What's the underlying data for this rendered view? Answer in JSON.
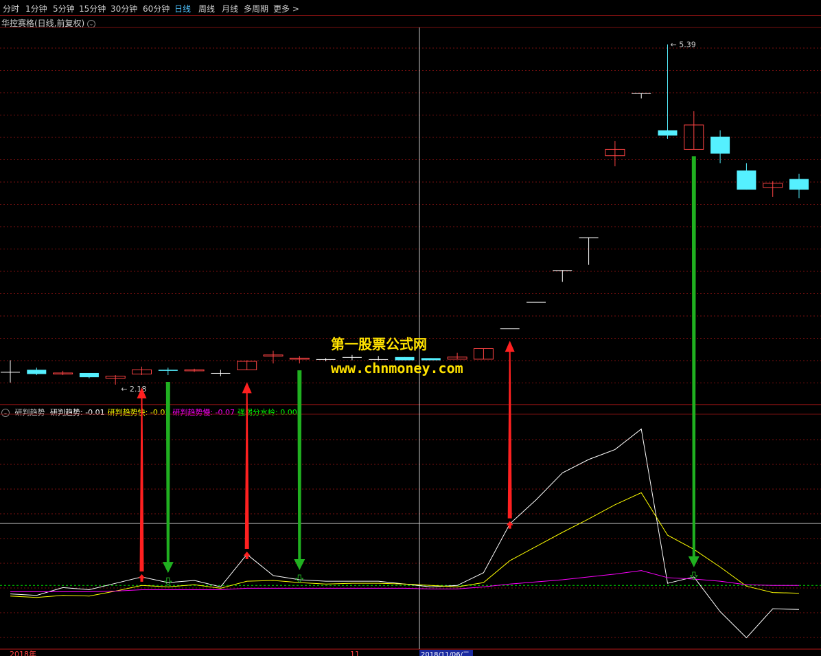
{
  "toolbar": {
    "items": [
      {
        "label": "分时"
      },
      {
        "label": "1分钟"
      },
      {
        "label": "5分钟"
      },
      {
        "label": "15分钟"
      },
      {
        "label": "30分钟"
      },
      {
        "label": "60分钟"
      },
      {
        "label": "日线",
        "active": true
      },
      {
        "label": "周线"
      },
      {
        "label": "月线"
      },
      {
        "label": "多周期"
      },
      {
        "label": "更多 >"
      }
    ]
  },
  "stock": {
    "title": "华控赛格(日线,前复权)",
    "menu_icon": "chevron-down-circle-icon"
  },
  "price_labels": {
    "low": "2.18",
    "high": "5.39"
  },
  "indicator": {
    "name": "研判趋势",
    "values": [
      {
        "label": "研判趋势: -0.01",
        "color": "#ffffff"
      },
      {
        "label": "研判趋势快: -0.01",
        "color": "#ffff00"
      },
      {
        "label": "研判趋势慢: -0.07",
        "color": "#ff00ff"
      },
      {
        "label": "强弱分水岭: 0.00",
        "color": "#00ff00"
      }
    ]
  },
  "axis": {
    "year": "2018年",
    "month": "11",
    "cursor_date": "2018/11/06/二"
  },
  "watermark": {
    "line1": "第一股票公式网",
    "line2": "www.chnmoney.com"
  },
  "colors": {
    "up": "#ff4444",
    "down": "#55f0ff",
    "grid": "#7a1010",
    "fast": "#ffff00",
    "slow": "#ff00ff",
    "zero": "#00dd00",
    "arrow_up": "#ff2020",
    "arrow_down": "#20b020"
  },
  "chart_data": {
    "type": "candlestick",
    "price_unit": "CNY",
    "candles": [
      {
        "o": 2.3,
        "c": 2.3,
        "h": 2.41,
        "l": 2.2
      },
      {
        "o": 2.32,
        "c": 2.28,
        "h": 2.34,
        "l": 2.27
      },
      {
        "o": 2.28,
        "c": 2.29,
        "h": 2.31,
        "l": 2.27
      },
      {
        "o": 2.29,
        "c": 2.25,
        "h": 2.29,
        "l": 2.24
      },
      {
        "o": 2.24,
        "c": 2.26,
        "h": 2.27,
        "l": 2.18
      },
      {
        "o": 2.28,
        "c": 2.32,
        "h": 2.35,
        "l": 2.27
      },
      {
        "o": 2.32,
        "c": 2.31,
        "h": 2.34,
        "l": 2.27
      },
      {
        "o": 2.31,
        "c": 2.32,
        "h": 2.33,
        "l": 2.3
      },
      {
        "o": 2.29,
        "c": 2.29,
        "h": 2.32,
        "l": 2.26
      },
      {
        "o": 2.32,
        "c": 2.4,
        "h": 2.41,
        "l": 2.32
      },
      {
        "o": 2.45,
        "c": 2.46,
        "h": 2.5,
        "l": 2.38
      },
      {
        "o": 2.42,
        "c": 2.43,
        "h": 2.45,
        "l": 2.38
      },
      {
        "o": 2.42,
        "c": 2.42,
        "h": 2.43,
        "l": 2.4
      },
      {
        "o": 2.44,
        "c": 2.44,
        "h": 2.46,
        "l": 2.41
      },
      {
        "o": 2.42,
        "c": 2.42,
        "h": 2.45,
        "l": 2.41
      },
      {
        "o": 2.44,
        "c": 2.41,
        "h": 2.44,
        "l": 2.41
      },
      {
        "o": 2.43,
        "c": 2.41,
        "h": 2.43,
        "l": 2.41
      },
      {
        "o": 2.42,
        "c": 2.44,
        "h": 2.48,
        "l": 2.42
      },
      {
        "o": 2.42,
        "c": 2.52,
        "h": 2.52,
        "l": 2.42
      },
      {
        "o": 2.71,
        "c": 2.71,
        "h": 2.71,
        "l": 2.71
      },
      {
        "o": 2.96,
        "c": 2.96,
        "h": 2.96,
        "l": 2.96
      },
      {
        "o": 3.26,
        "c": 3.26,
        "h": 3.26,
        "l": 3.15
      },
      {
        "o": 3.57,
        "c": 3.57,
        "h": 3.57,
        "l": 3.31
      },
      {
        "o": 4.34,
        "c": 4.4,
        "h": 4.48,
        "l": 4.24
      },
      {
        "o": 4.93,
        "c": 4.93,
        "h": 4.93,
        "l": 4.88
      },
      {
        "o": 4.58,
        "c": 4.53,
        "h": 5.39,
        "l": 4.5
      },
      {
        "o": 4.4,
        "c": 4.63,
        "h": 4.76,
        "l": 4.4
      },
      {
        "o": 4.52,
        "c": 4.36,
        "h": 4.58,
        "l": 4.27
      },
      {
        "o": 4.2,
        "c": 4.02,
        "h": 4.27,
        "l": 4.02
      },
      {
        "o": 4.04,
        "c": 4.08,
        "h": 4.1,
        "l": 3.95
      },
      {
        "o": 4.12,
        "c": 4.02,
        "h": 4.17,
        "l": 3.94
      }
    ],
    "indicator_series": [
      {
        "name": "研判趋势",
        "color": "#ffffff",
        "values": [
          -0.012,
          -0.014,
          -0.003,
          -0.006,
          0.003,
          0.012,
          0.004,
          0.007,
          -0.002,
          0.044,
          0.014,
          0.008,
          0.006,
          0.006,
          0.006,
          0.002,
          -0.002,
          0.0,
          0.018,
          0.087,
          0.121,
          0.159,
          0.178,
          0.192,
          0.221,
          0.003,
          0.012,
          -0.037,
          -0.074,
          -0.033,
          -0.034
        ]
      },
      {
        "name": "研判趋势快",
        "color": "#ffff00",
        "values": [
          -0.015,
          -0.017,
          -0.014,
          -0.015,
          -0.008,
          0.0,
          -0.002,
          0.001,
          -0.004,
          0.006,
          0.007,
          0.004,
          0.002,
          0.003,
          0.003,
          0.002,
          0.0,
          -0.002,
          0.004,
          0.035,
          0.055,
          0.075,
          0.094,
          0.114,
          0.131,
          0.071,
          0.051,
          0.026,
          -0.001,
          -0.01,
          -0.011
        ]
      },
      {
        "name": "研判趋势慢",
        "color": "#ff00ff",
        "values": [
          -0.009,
          -0.009,
          -0.009,
          -0.009,
          -0.008,
          -0.006,
          -0.006,
          -0.006,
          -0.006,
          -0.004,
          -0.004,
          -0.004,
          -0.004,
          -0.004,
          -0.004,
          -0.004,
          -0.005,
          -0.005,
          -0.002,
          0.002,
          0.005,
          0.008,
          0.012,
          0.016,
          0.021,
          0.011,
          0.009,
          0.006,
          0.001,
          0.0,
          0.0
        ]
      }
    ],
    "signals": [
      {
        "i": 5,
        "type": "buy"
      },
      {
        "i": 6,
        "type": "sell"
      },
      {
        "i": 9,
        "type": "buy"
      },
      {
        "i": 11,
        "type": "sell"
      },
      {
        "i": 19,
        "type": "buy"
      },
      {
        "i": 26,
        "type": "sell"
      }
    ]
  }
}
